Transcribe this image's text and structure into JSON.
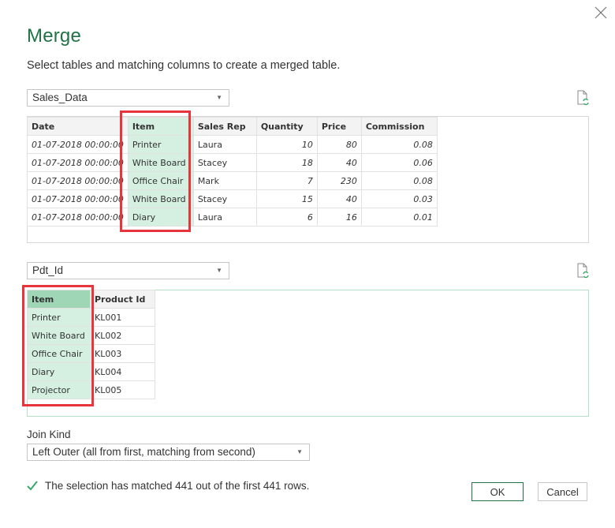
{
  "dialog": {
    "title": "Merge",
    "subtitle": "Select tables and matching columns to create a merged table.",
    "close_icon": "close-icon"
  },
  "first_table": {
    "selected": "Sales_Data",
    "refresh_icon": "refresh-document-icon",
    "selected_column": "Item",
    "columns": [
      "Date",
      "Item",
      "Sales Rep",
      "Quantity",
      "Price",
      "Commission"
    ],
    "rows": [
      [
        "01-07-2018 00:00:00",
        "Printer",
        "Laura",
        "10",
        "80",
        "0.08"
      ],
      [
        "01-07-2018 00:00:00",
        "White Board",
        "Stacey",
        "18",
        "40",
        "0.06"
      ],
      [
        "01-07-2018 00:00:00",
        "Office Chair",
        "Mark",
        "7",
        "230",
        "0.08"
      ],
      [
        "01-07-2018 00:00:00",
        "White Board",
        "Stacey",
        "15",
        "40",
        "0.03"
      ],
      [
        "01-07-2018 00:00:00",
        "Diary",
        "Laura",
        "6",
        "16",
        "0.01"
      ]
    ]
  },
  "second_table": {
    "selected": "Pdt_Id",
    "refresh_icon": "refresh-document-icon",
    "selected_column": "Item",
    "columns": [
      "Item",
      "Product Id"
    ],
    "rows": [
      [
        "Printer",
        "KL001"
      ],
      [
        "White Board",
        "KL002"
      ],
      [
        "Office Chair",
        "KL003"
      ],
      [
        "Diary",
        "KL004"
      ],
      [
        "Projector",
        "KL005"
      ]
    ]
  },
  "join": {
    "label": "Join Kind",
    "selected": "Left Outer (all from first, matching from second)"
  },
  "status": {
    "icon": "checkmark-icon",
    "text": "The selection has matched 441 out of the first 441 rows."
  },
  "buttons": {
    "ok": "OK",
    "cancel": "Cancel"
  },
  "colors": {
    "accent": "#217346",
    "selected_column": "#d5efe0",
    "highlight_box": "#e8343c"
  }
}
